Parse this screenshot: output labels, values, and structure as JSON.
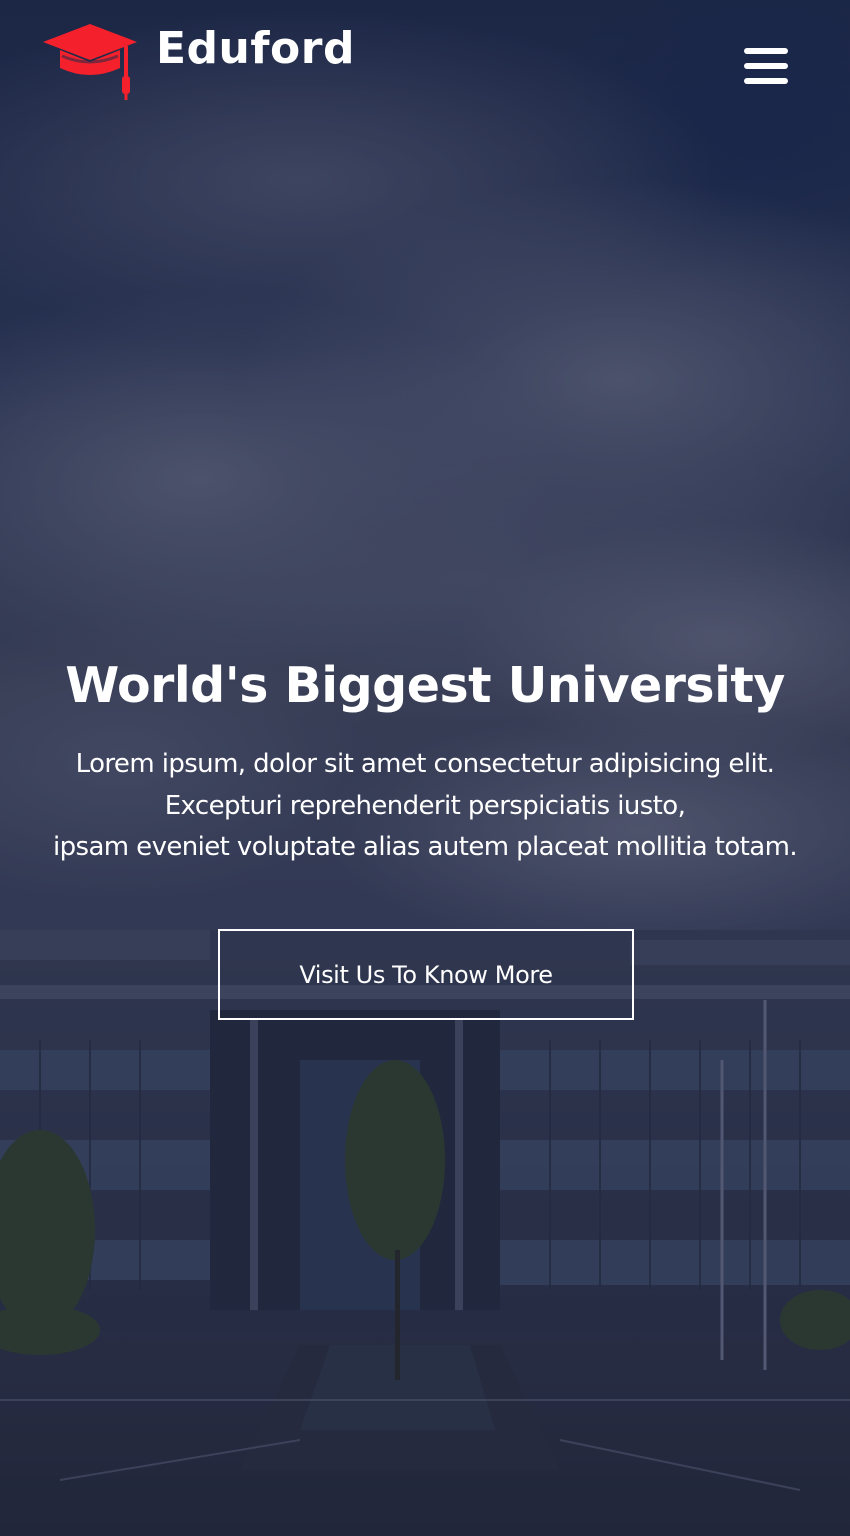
{
  "header": {
    "brand_name": "Eduford",
    "logo_icon": "graduation-cap-icon",
    "menu_icon": "hamburger-menu-icon"
  },
  "hero": {
    "title": "World's Biggest University",
    "description_lines": [
      "Lorem ipsum, dolor sit amet consectetur adipisicing elit.",
      "Excepturi reprehenderit perspiciatis iusto,",
      "ipsam eveniet voluptate alias autem placeat mollitia totam."
    ],
    "cta_label": "Visit Us To Know More"
  },
  "colors": {
    "accent": "#f4212c",
    "text": "#ffffff",
    "overlay": "#1c2648"
  }
}
